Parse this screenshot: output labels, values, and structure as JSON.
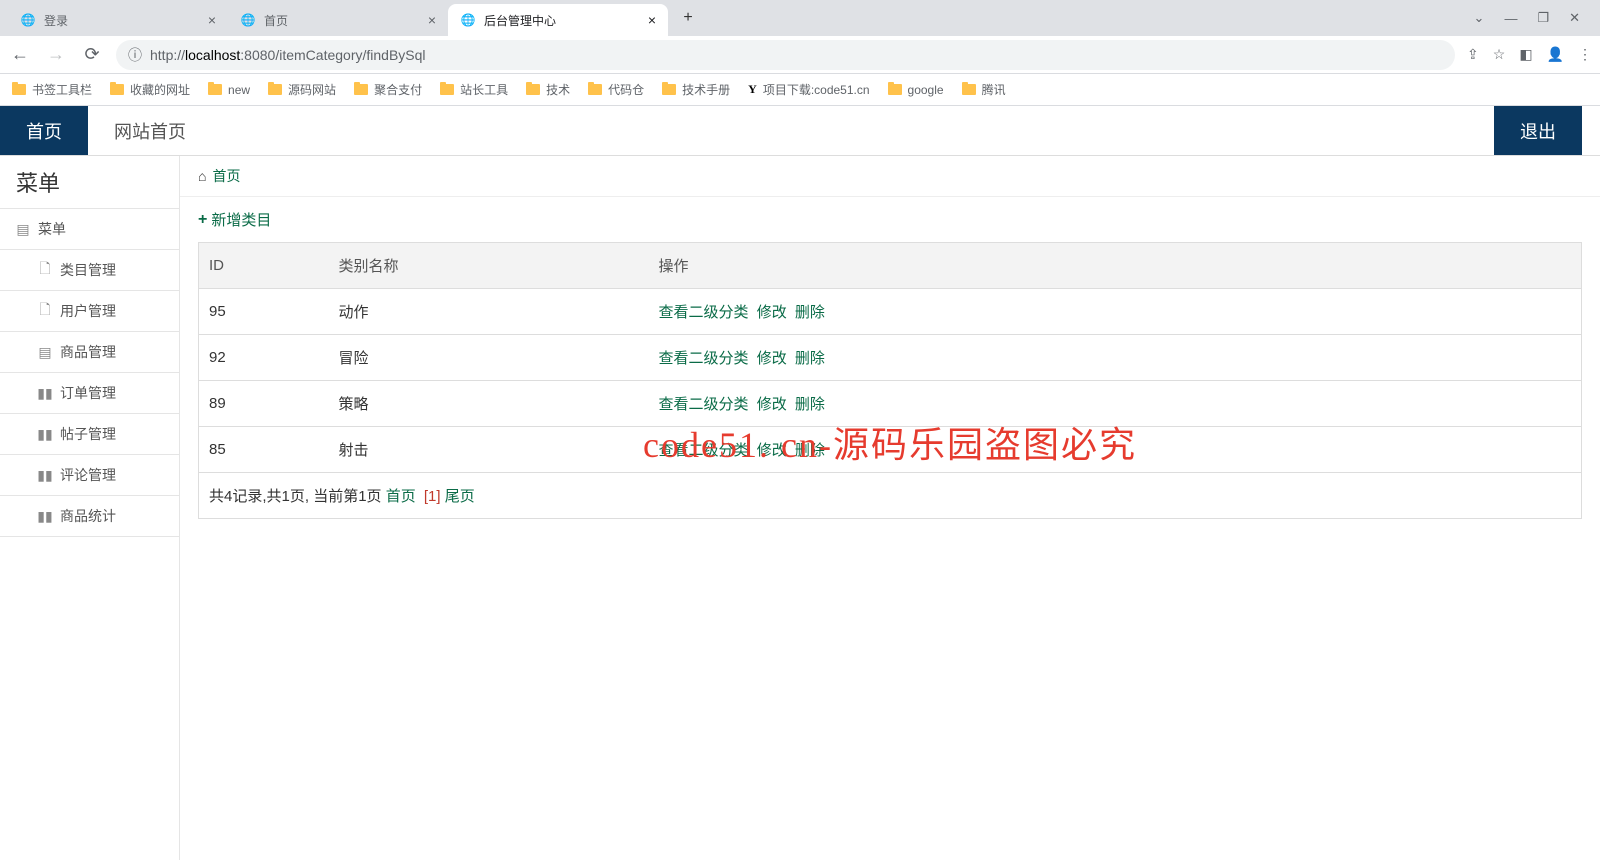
{
  "browser": {
    "tabs": [
      {
        "title": "登录",
        "active": false
      },
      {
        "title": "首页",
        "active": false
      },
      {
        "title": "后台管理中心",
        "active": true
      }
    ],
    "url_prefix": "http://",
    "url_host": "localhost",
    "url_rest": ":8080/itemCategory/findBySql",
    "bookmarks": [
      "书签工具栏",
      "收藏的网址",
      "new",
      "源码网站",
      "聚合支付",
      "站长工具",
      "技术",
      "代码仓",
      "技术手册",
      "项目下载:code51.cn",
      "google",
      "腾讯"
    ]
  },
  "app": {
    "topbar": {
      "home": "首页",
      "site_home": "网站首页",
      "logout": "退出"
    },
    "sidebar": {
      "title": "菜单",
      "group_label": "菜单",
      "items": [
        "类目管理",
        "用户管理",
        "商品管理",
        "订单管理",
        "帖子管理",
        "评论管理",
        "商品统计"
      ]
    },
    "breadcrumb": {
      "home": "首页"
    },
    "add_button": "新增类目",
    "table": {
      "headers": {
        "id": "ID",
        "name": "类别名称",
        "action": "操作"
      },
      "rows": [
        {
          "id": "95",
          "name": "动作"
        },
        {
          "id": "92",
          "name": "冒险"
        },
        {
          "id": "89",
          "name": "策略"
        },
        {
          "id": "85",
          "name": "射击"
        }
      ],
      "actions": {
        "view": "查看二级分类",
        "edit": "修改",
        "delete": "删除"
      }
    },
    "pager": {
      "summary": "共4记录,共1页, 当前第1页",
      "first": "首页",
      "page": "[1]",
      "last": "尾页"
    },
    "watermark": "code51. cn-源码乐园盗图必究"
  }
}
